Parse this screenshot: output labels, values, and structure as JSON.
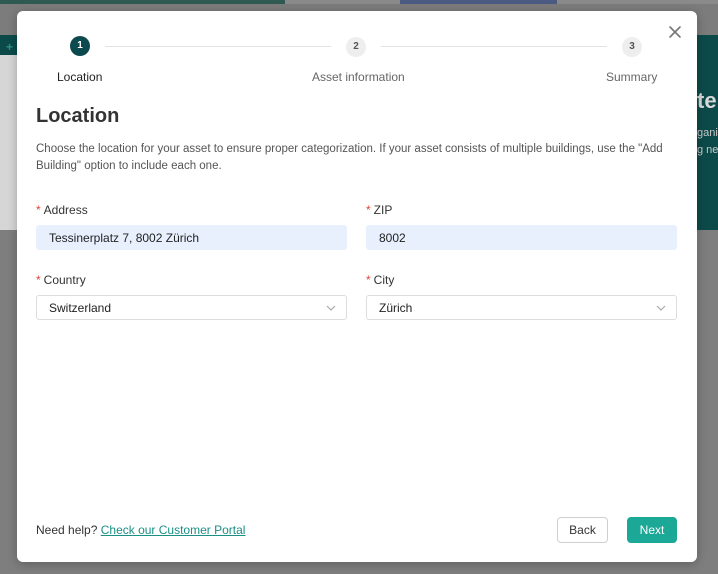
{
  "background": {
    "heading_fragment": "te",
    "line1_fragment": "gani",
    "line2_fragment": "g nea",
    "plus_icon": "plus-icon"
  },
  "stepper": {
    "steps": [
      {
        "number": "1",
        "label": "Location",
        "state": "active"
      },
      {
        "number": "2",
        "label": "Asset information",
        "state": "inactive"
      },
      {
        "number": "3",
        "label": "Summary",
        "state": "inactive"
      }
    ]
  },
  "page": {
    "title": "Location",
    "description": "Choose the location for your asset to ensure proper categorization. If your asset consists of multiple buildings, use the \"Add Building\" option to include each one."
  },
  "form": {
    "address": {
      "label": "Address",
      "required": "*",
      "value": "Tessinerplatz 7, 8002 Zürich"
    },
    "zip": {
      "label": "ZIP",
      "required": "*",
      "value": "8002"
    },
    "country": {
      "label": "Country",
      "required": "*",
      "value": "Switzerland"
    },
    "city": {
      "label": "City",
      "required": "*",
      "value": "Zürich"
    }
  },
  "footer": {
    "help_text": "Need help?",
    "help_link": "Check our Customer Portal",
    "back_label": "Back",
    "next_label": "Next"
  },
  "colors": {
    "active_step": "#0d4a4f",
    "primary_button": "#1ba896",
    "link": "#1a8f86",
    "required": "#e0463a",
    "filled_input": "#e8f0fe"
  },
  "icons": {
    "close": "close-icon",
    "select": "chevron-down-icon"
  }
}
